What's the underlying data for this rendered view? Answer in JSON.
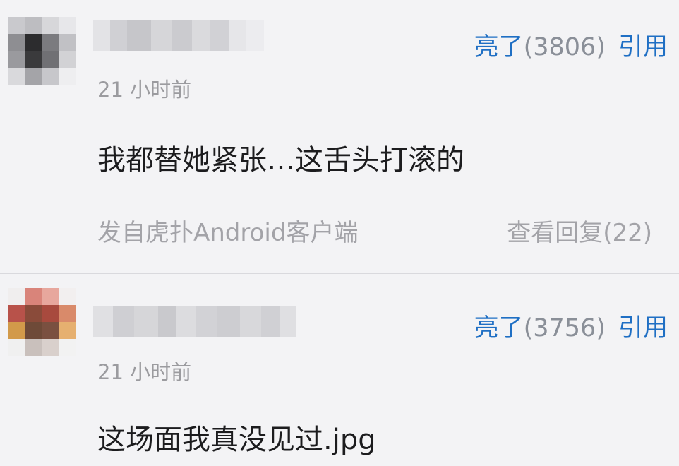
{
  "comments": [
    {
      "username": "",
      "timestamp": "21 小时前",
      "like_label": "亮了",
      "like_count": "(3806)",
      "quote_label": "引用",
      "body": "我都替她紧张…这舌头打滚的",
      "source": "发自虎扑Android客户端",
      "view_replies": "查看回复(22)",
      "avatar_colors": [
        "#c9c9cd",
        "#bdbdc1",
        "#d7d7da",
        "#e7e7ea",
        "#8e8e92",
        "#2c2c2e",
        "#7b7b7f",
        "#c1c1c5",
        "#9a9a9e",
        "#3a3a3c",
        "#707074",
        "#d2d2d5",
        "#d9d9dc",
        "#a4a4a8",
        "#c7c7cb",
        "#eeeef0"
      ]
    },
    {
      "username": "",
      "timestamp": "21 小时前",
      "like_label": "亮了",
      "like_count": "(3756)",
      "quote_label": "引用",
      "body": "这场面我真没见过.jpg",
      "source": "",
      "view_replies": "",
      "avatar_colors": [
        "#f0eeee",
        "#d9847a",
        "#e7a79d",
        "#f2efef",
        "#b8524a",
        "#8a4b3a",
        "#a84a3e",
        "#d98a6a",
        "#d29a4a",
        "#6e4a38",
        "#7a5040",
        "#e6b070",
        "#f0f0f0",
        "#c9c0bc",
        "#d9d0cc",
        "#f2f2f2"
      ]
    }
  ]
}
